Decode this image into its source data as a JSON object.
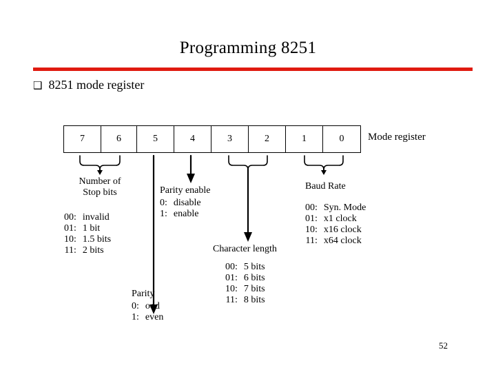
{
  "slide": {
    "title": "Programming 8251",
    "page_number": "52",
    "accent_color": "#e01b10"
  },
  "bullet": {
    "glyph": "❑",
    "glyph_name": "hollow-square-bullet",
    "text": "8251 mode register"
  },
  "register": {
    "label": "Mode register",
    "bits": [
      "7",
      "6",
      "5",
      "4",
      "3",
      "2",
      "1",
      "0"
    ]
  },
  "annotations": {
    "stop_bits": {
      "heading_line1": "Number of",
      "heading_line2": "Stop bits",
      "rows": [
        {
          "key": "00:",
          "value": "invalid"
        },
        {
          "key": "01:",
          "value": "1 bit"
        },
        {
          "key": "10:",
          "value": "1.5 bits"
        },
        {
          "key": "11:",
          "value": "2 bits"
        }
      ]
    },
    "parity_enable": {
      "heading": "Parity enable",
      "rows": [
        {
          "key": "0:",
          "value": "disable"
        },
        {
          "key": "1:",
          "value": "enable"
        }
      ]
    },
    "parity": {
      "heading": "Parity",
      "rows": [
        {
          "key": "0:",
          "value": "odd"
        },
        {
          "key": "1:",
          "value": "even"
        }
      ]
    },
    "character_length": {
      "heading": "Character length",
      "rows": [
        {
          "key": "00:",
          "value": "5 bits"
        },
        {
          "key": "01:",
          "value": "6 bits"
        },
        {
          "key": "10:",
          "value": "7 bits"
        },
        {
          "key": "11:",
          "value": "8 bits"
        }
      ]
    },
    "baud_rate": {
      "heading": "Baud Rate",
      "rows": [
        {
          "key": "00:",
          "value": "Syn. Mode"
        },
        {
          "key": "01:",
          "value": "x1 clock"
        },
        {
          "key": "10:",
          "value": "x16 clock"
        },
        {
          "key": "11:",
          "value": "x64 clock"
        }
      ]
    }
  }
}
